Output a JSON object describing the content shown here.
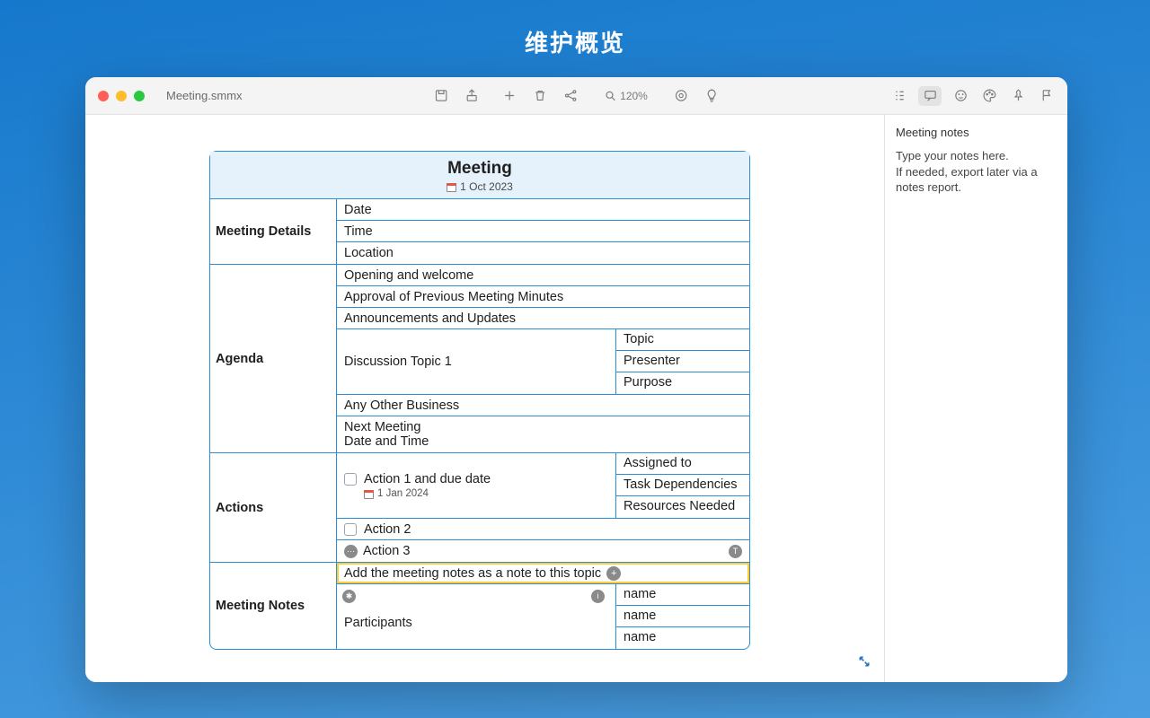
{
  "page": {
    "title": "维护概览"
  },
  "window": {
    "filename": "Meeting.smmx",
    "zoom": "120%"
  },
  "mindmap": {
    "title": "Meeting",
    "date": "1 Oct 2023",
    "sections": {
      "details": {
        "label": "Meeting Details",
        "rows": [
          "Date",
          "Time",
          "Location"
        ]
      },
      "agenda": {
        "label": "Agenda",
        "rows_top": [
          "Opening and welcome",
          "Approval of Previous Meeting Minutes",
          "Announcements and Updates"
        ],
        "discussion": {
          "label": "Discussion Topic 1",
          "sub": [
            "Topic",
            "Presenter",
            "Purpose"
          ]
        },
        "rows_bottom": [
          "Any Other Business"
        ],
        "next": {
          "line1": "Next Meeting",
          "line2": "Date and Time"
        }
      },
      "actions": {
        "label": "Actions",
        "a1": {
          "label": "Action 1 and due date",
          "date": "1 Jan 2024",
          "sub": [
            "Assigned to",
            "Task Dependencies",
            "Resources Needed"
          ]
        },
        "a2": "Action 2",
        "a3": "Action 3"
      },
      "notes": {
        "label": "Meeting Notes",
        "instruction": "Add the meeting notes as a note to this topic",
        "participants_label": "Participants",
        "names": [
          "name",
          "name",
          "name"
        ]
      }
    }
  },
  "sidebar": {
    "title": "Meeting notes",
    "line1": "Type your notes here.",
    "line2": "If needed, export later via a notes report."
  }
}
